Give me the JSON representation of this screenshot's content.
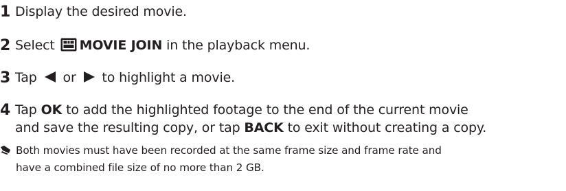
{
  "steps": [
    {
      "number": "1",
      "text": "Display the desired movie."
    },
    {
      "number": "2",
      "prefix": "Select ",
      "icon": "movie-join-icon",
      "bold": "MOVIE JOIN",
      "suffix": " in the playback menu."
    },
    {
      "number": "3",
      "prefix": "Tap ",
      "left_icon": "left-triangle-icon",
      "middle": " or ",
      "right_icon": "right-triangle-icon",
      "suffix": " to highlight a movie."
    },
    {
      "number": "4",
      "line1_prefix": "Tap ",
      "line1_bold": "OK",
      "line1_suffix": " to add the highlighted footage to the end of the current movie",
      "line2_prefix": "and save the resulting copy, or tap ",
      "line2_bold": "BACK",
      "line2_suffix": " to exit without creating a copy."
    }
  ],
  "note": {
    "icon": "note-pencil-icon",
    "line1": "Both movies must have been recorded at the same frame size and frame rate and",
    "line2": "have a combined file size of no more than 2 GB."
  },
  "colors": {
    "text": "#231f20"
  }
}
